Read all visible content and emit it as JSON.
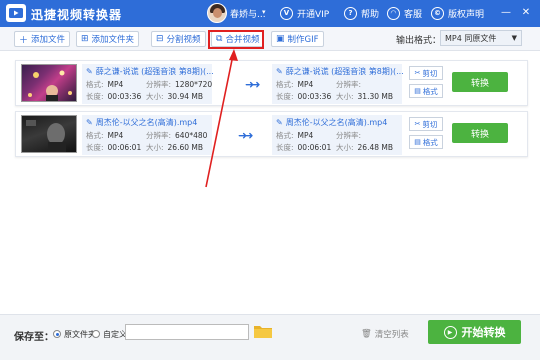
{
  "app": {
    "title": "迅捷视频转换器",
    "user_name": "春娇与...",
    "user_dropdown": "▾"
  },
  "titlebar_items": {
    "vip": "开通VIP",
    "help": "帮助",
    "service": "客服",
    "copyright": "版权声明"
  },
  "toolbar": {
    "add_file": "添加文件",
    "add_folder": "添加文件夹",
    "split_video": "分割视频",
    "merge_video": "合并视频",
    "make_gif": "制作GIF",
    "output_format_label": "输出格式：",
    "output_format_value": "MP4  同原文件"
  },
  "files": [
    {
      "src_name": "薛之谦-说谎 (超强音浪 第8期)(...",
      "src_format_label": "格式:",
      "src_format": "MP4",
      "src_res_label": "分辨率:",
      "src_res": "1280*720",
      "src_dur_label": "长度:",
      "src_dur": "00:03:36",
      "src_size_label": "大小:",
      "src_size": "30.94 MB",
      "dst_name": "薛之谦-说谎 (超强音浪 第8期)(...",
      "dst_format_label": "格式:",
      "dst_format": "MP4",
      "dst_res_label": "分辨率:",
      "dst_res": "",
      "dst_dur_label": "长度:",
      "dst_dur": "00:03:36",
      "dst_size_label": "大小:",
      "dst_size": "31.30 MB",
      "cut": "剪切",
      "format": "格式",
      "convert": "转换"
    },
    {
      "src_name": "周杰伦-以父之名(高清).mp4",
      "src_format_label": "格式:",
      "src_format": "MP4",
      "src_res_label": "分辨率:",
      "src_res": "640*480",
      "src_dur_label": "长度:",
      "src_dur": "00:06:01",
      "src_size_label": "大小:",
      "src_size": "26.60 MB",
      "dst_name": "周杰伦-以父之名(高清).mp4",
      "dst_format_label": "格式:",
      "dst_format": "MP4",
      "dst_res_label": "分辨率:",
      "dst_res": "",
      "dst_dur_label": "长度:",
      "dst_dur": "00:06:01",
      "dst_size_label": "大小:",
      "dst_size": "26.48 MB",
      "cut": "剪切",
      "format": "格式",
      "convert": "转换"
    }
  ],
  "bottom": {
    "save_to": "保存至：",
    "option_source": "原文件夹",
    "option_custom": "自定义",
    "path_value": "",
    "clear_list": "清空列表",
    "start_convert": "开始转换"
  },
  "colors": {
    "brand_blue": "#2e6dd8",
    "convert_green": "#4cb340",
    "annotation_red": "#e02020"
  }
}
